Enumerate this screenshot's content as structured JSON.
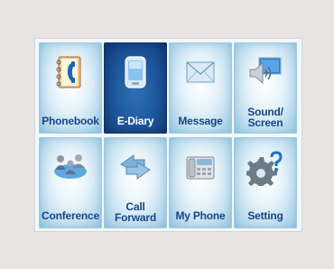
{
  "menu": {
    "items": [
      {
        "label": "Phonebook",
        "icon": "phonebook-icon",
        "selected": false
      },
      {
        "label": "E-Diary",
        "icon": "pda-icon",
        "selected": true
      },
      {
        "label": "Message",
        "icon": "envelope-icon",
        "selected": false
      },
      {
        "label": "Sound/\nScreen",
        "icon": "speaker-screen-icon",
        "selected": false
      },
      {
        "label": "Conference",
        "icon": "conference-icon",
        "selected": false
      },
      {
        "label": "Call\nForward",
        "icon": "call-forward-icon",
        "selected": false
      },
      {
        "label": "My Phone",
        "icon": "desk-phone-icon",
        "selected": false
      },
      {
        "label": "Setting",
        "icon": "gear-icon",
        "selected": false
      }
    ]
  },
  "colors": {
    "label_text": "#17458c",
    "selected_tile": "#1f5aa0",
    "background": "#e9e4e2"
  }
}
